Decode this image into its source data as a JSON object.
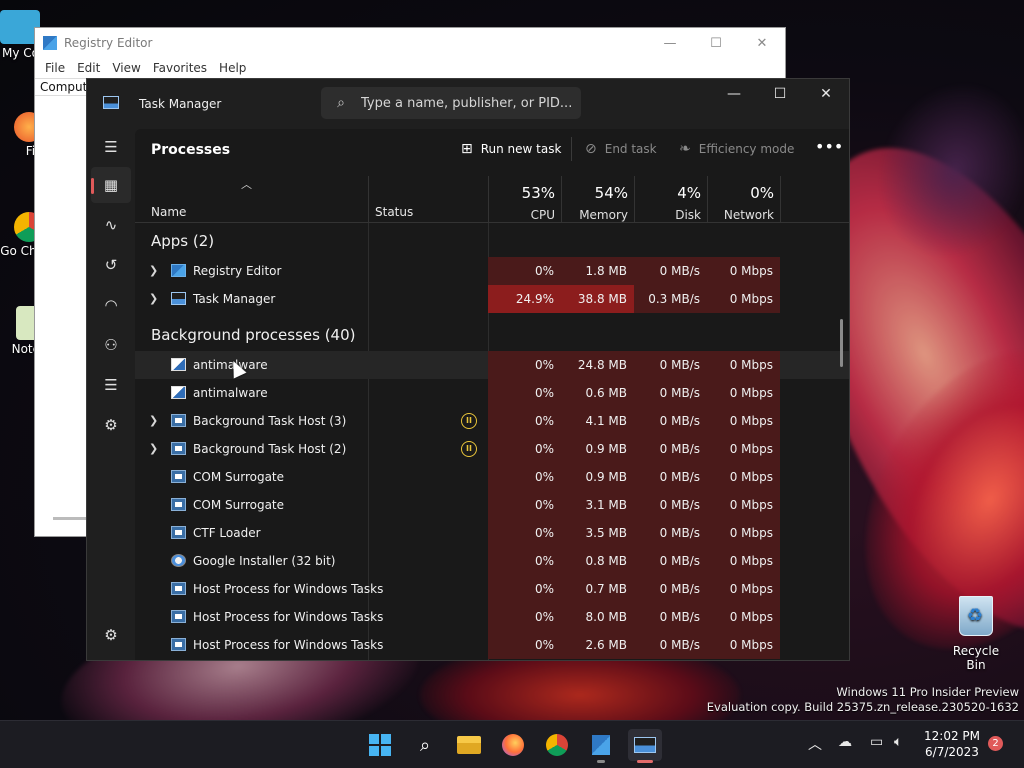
{
  "desktop": {
    "icons": [
      {
        "label": "My Co",
        "icon": "computer-icon"
      },
      {
        "label": "Fir",
        "icon": "firefox-icon"
      },
      {
        "label": "Go Chi",
        "icon": "chrome-icon"
      },
      {
        "label": "Note",
        "icon": "notepad-icon"
      }
    ],
    "recycle_bin": "Recycle Bin",
    "watermark_line1": "Windows 11 Pro Insider Preview",
    "watermark_line2": "Evaluation copy. Build 25375.zn_release.230520-1632"
  },
  "regedit": {
    "title": "Registry Editor",
    "menu": [
      "File",
      "Edit",
      "View",
      "Favorites",
      "Help"
    ],
    "address": "Compute"
  },
  "task_manager": {
    "title": "Task Manager",
    "search_placeholder": "Type a name, publisher, or PID...",
    "page_title": "Processes",
    "commands": {
      "run_new_task": "Run new task",
      "end_task": "End task",
      "efficiency_mode": "Efficiency mode"
    },
    "columns": {
      "name": "Name",
      "status": "Status",
      "cpu_pct": "53%",
      "cpu_label": "CPU",
      "mem_pct": "54%",
      "mem_label": "Memory",
      "disk_pct": "4%",
      "disk_label": "Disk",
      "net_pct": "0%",
      "net_label": "Network"
    },
    "sections": {
      "apps": "Apps (2)",
      "background": "Background processes (40)"
    },
    "apps": [
      {
        "name": "Registry Editor",
        "icon": "regedit-icon",
        "expandable": true,
        "cpu": "0%",
        "mem": "1.8 MB",
        "disk": "0 MB/s",
        "net": "0 Mbps"
      },
      {
        "name": "Task Manager",
        "icon": "task-manager-icon",
        "expandable": true,
        "cpu": "24.9%",
        "mem": "38.8 MB",
        "disk": "0.3 MB/s",
        "net": "0 Mbps"
      }
    ],
    "background": [
      {
        "name": "antimalware",
        "icon": "antimalware-icon",
        "expandable": false,
        "status": "",
        "cpu": "0%",
        "mem": "24.8 MB",
        "disk": "0 MB/s",
        "net": "0 Mbps"
      },
      {
        "name": "antimalware",
        "icon": "antimalware-icon",
        "expandable": false,
        "status": "",
        "cpu": "0%",
        "mem": "0.6 MB",
        "disk": "0 MB/s",
        "net": "0 Mbps"
      },
      {
        "name": "Background Task Host (3)",
        "icon": "app-window-icon",
        "expandable": true,
        "status": "suspended",
        "cpu": "0%",
        "mem": "4.1 MB",
        "disk": "0 MB/s",
        "net": "0 Mbps"
      },
      {
        "name": "Background Task Host (2)",
        "icon": "app-window-icon",
        "expandable": true,
        "status": "suspended",
        "cpu": "0%",
        "mem": "0.9 MB",
        "disk": "0 MB/s",
        "net": "0 Mbps"
      },
      {
        "name": "COM Surrogate",
        "icon": "app-window-icon",
        "expandable": false,
        "status": "",
        "cpu": "0%",
        "mem": "0.9 MB",
        "disk": "0 MB/s",
        "net": "0 Mbps"
      },
      {
        "name": "COM Surrogate",
        "icon": "app-window-icon",
        "expandable": false,
        "status": "",
        "cpu": "0%",
        "mem": "3.1 MB",
        "disk": "0 MB/s",
        "net": "0 Mbps"
      },
      {
        "name": "CTF Loader",
        "icon": "app-window-icon",
        "expandable": false,
        "status": "",
        "cpu": "0%",
        "mem": "3.5 MB",
        "disk": "0 MB/s",
        "net": "0 Mbps"
      },
      {
        "name": "Google Installer (32 bit)",
        "icon": "google-installer-icon",
        "expandable": false,
        "status": "",
        "cpu": "0%",
        "mem": "0.8 MB",
        "disk": "0 MB/s",
        "net": "0 Mbps"
      },
      {
        "name": "Host Process for Windows Tasks",
        "icon": "app-window-icon",
        "expandable": false,
        "status": "",
        "cpu": "0%",
        "mem": "0.7 MB",
        "disk": "0 MB/s",
        "net": "0 Mbps"
      },
      {
        "name": "Host Process for Windows Tasks",
        "icon": "app-window-icon",
        "expandable": false,
        "status": "",
        "cpu": "0%",
        "mem": "8.0 MB",
        "disk": "0 MB/s",
        "net": "0 Mbps"
      },
      {
        "name": "Host Process for Windows Tasks",
        "icon": "app-window-icon",
        "expandable": false,
        "status": "",
        "cpu": "0%",
        "mem": "2.6 MB",
        "disk": "0 MB/s",
        "net": "0 Mbps"
      }
    ],
    "colors": {
      "heat_low": "#4a1a1a",
      "heat_high": "#8c1d1d",
      "accent": "#e05a5a",
      "suspended": "#e8c43a"
    }
  },
  "taskbar": {
    "clock_time": "12:02 PM",
    "clock_date": "6/7/2023",
    "notification_count": "2"
  }
}
